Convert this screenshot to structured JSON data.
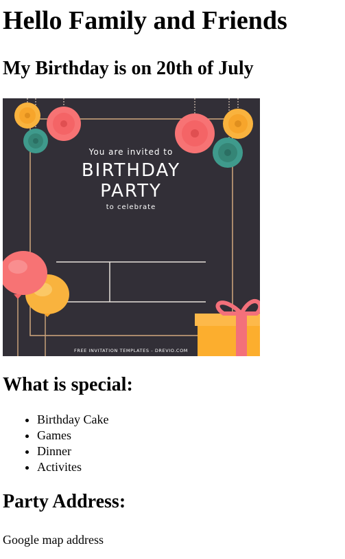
{
  "heading": "Hello Family and Friends",
  "birthday_line": "My Birthday is on 20th of July",
  "invitation": {
    "line1": "You are invited to",
    "line2": "BIRTHDAY",
    "line3": "PARTY",
    "line4": "to celebrate",
    "footer": "FREE INVITATION TEMPLATES - DREVIO.COM",
    "colors": {
      "background": "#322f37",
      "frame": "#c9a27a",
      "pink": "#f77374",
      "orange": "#f9b33e",
      "teal": "#3f9a8c",
      "gift_yellow": "#fdb94a",
      "ribbon": "#f3707a"
    }
  },
  "special": {
    "title": "What is special:",
    "items": [
      "Birthday Cake",
      "Games",
      "Dinner",
      "Activites"
    ]
  },
  "address": {
    "title": "Party Address:",
    "text": "Google map address"
  }
}
